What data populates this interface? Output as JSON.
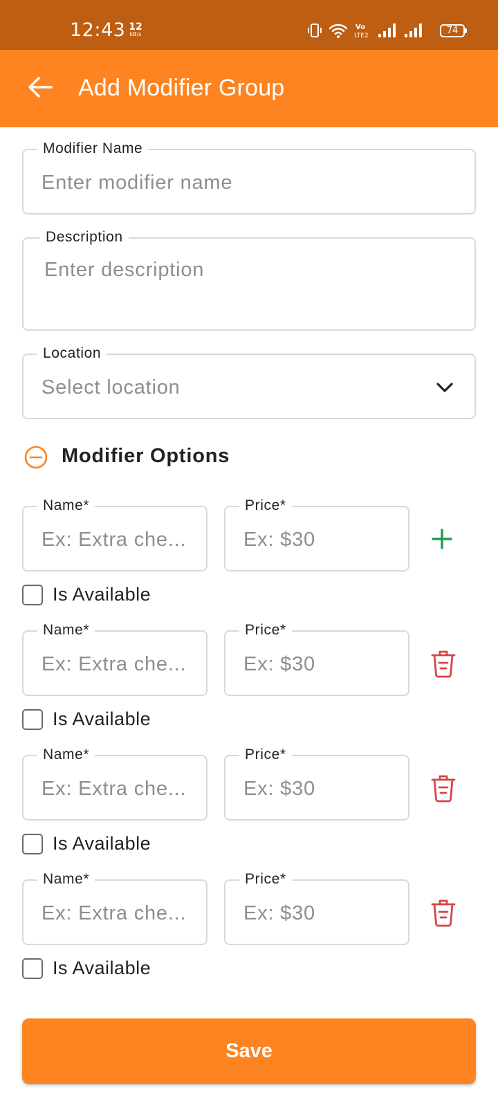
{
  "status_bar": {
    "time": "12:43",
    "speed_value": "12",
    "speed_unit": "kB/s",
    "battery": "74"
  },
  "header": {
    "title": "Add Modifier Group",
    "back_icon": "arrow-left-icon"
  },
  "form": {
    "modifier_name": {
      "label": "Modifier Name",
      "placeholder": "Enter modifier name",
      "value": ""
    },
    "description": {
      "label": "Description",
      "placeholder": "Enter description",
      "value": ""
    },
    "location": {
      "label": "Location",
      "placeholder": "Select location",
      "icon": "chevron-down-icon"
    }
  },
  "modifier_options": {
    "title": "Modifier Options",
    "collapse_icon": "minus-circle-icon",
    "items": [
      {
        "name_label": "Name*",
        "name_placeholder": "Ex: Extra che...",
        "price_label": "Price*",
        "price_placeholder": "Ex: $30",
        "action_icon": "plus-icon",
        "available_label": "Is Available",
        "available": false
      },
      {
        "name_label": "Name*",
        "name_placeholder": "Ex: Extra che...",
        "price_label": "Price*",
        "price_placeholder": "Ex: $30",
        "action_icon": "trash-icon",
        "available_label": "Is Available",
        "available": false
      },
      {
        "name_label": "Name*",
        "name_placeholder": "Ex: Extra che...",
        "price_label": "Price*",
        "price_placeholder": "Ex: $30",
        "action_icon": "trash-icon",
        "available_label": "Is Available",
        "available": false
      },
      {
        "name_label": "Name*",
        "name_placeholder": "Ex: Extra che...",
        "price_label": "Price*",
        "price_placeholder": "Ex: $30",
        "action_icon": "trash-icon",
        "available_label": "Is Available",
        "available": false
      }
    ]
  },
  "actions": {
    "save_label": "Save"
  },
  "colors": {
    "status_bar": "#BE5E12",
    "primary": "#FD8420",
    "add": "#1E9C4A",
    "delete": "#D64545",
    "border": "#D9D9D9"
  }
}
